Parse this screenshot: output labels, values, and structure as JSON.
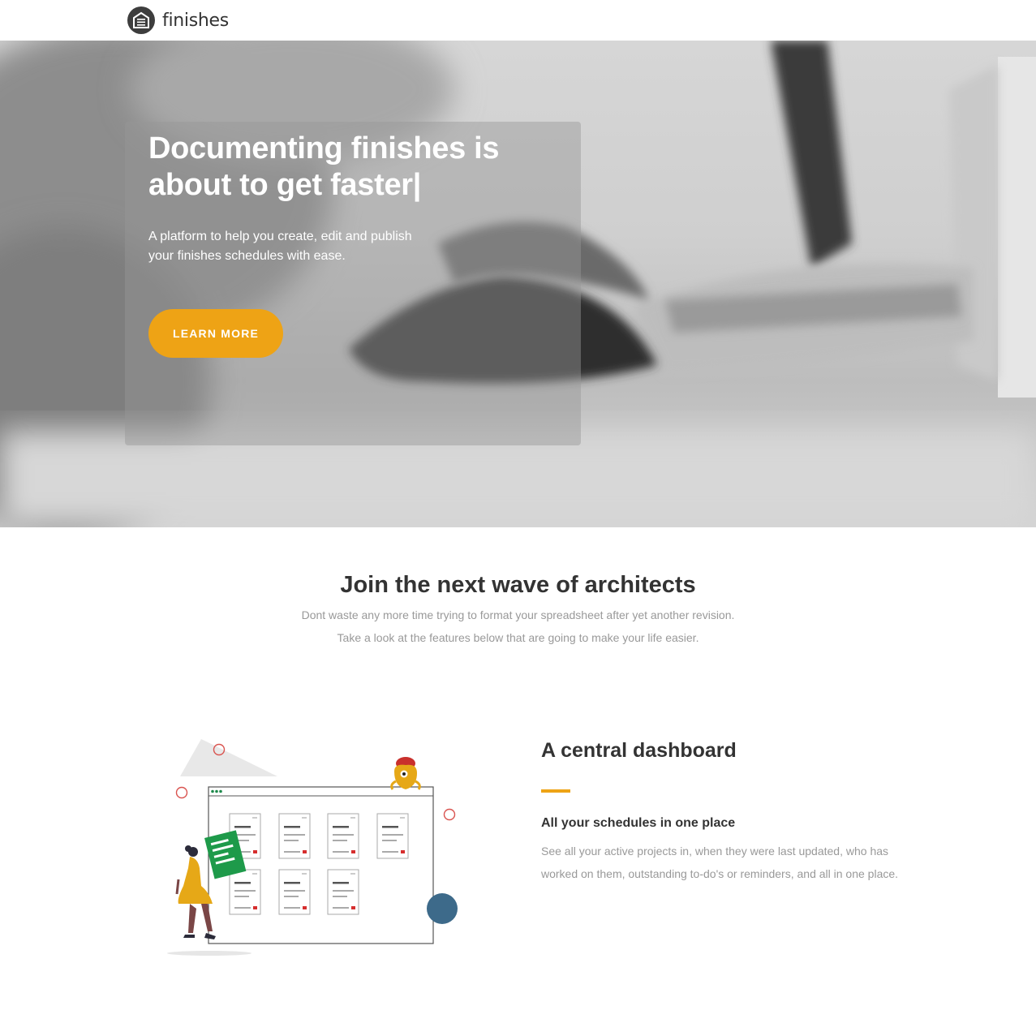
{
  "header": {
    "logo_text": "finishes",
    "logo_icon": "building-doc-icon"
  },
  "hero": {
    "title_line1": "Documenting finishes is",
    "title_line2": "about to get faster|",
    "subtitle_line1": "A platform to help you create, edit and publish",
    "subtitle_line2": "your finishes schedules with ease.",
    "cta_label": "LEARN MORE",
    "background": "hand-on-mouse-photo"
  },
  "intro": {
    "title": "Join the next wave of architects",
    "line1": "Dont waste any more time trying to format your spreadsheet after yet another revision.",
    "line2": "Take a look at the features below that are going to make your life easier."
  },
  "feature": {
    "illustration": "dashboard-illustration",
    "title": "A central dashboard",
    "subtitle": "All your schedules in one place",
    "description": "See all your active projects in, when they were last updated, who has worked on them, outstanding to-do's or reminders, and all in one place."
  },
  "colors": {
    "accent": "#eea315",
    "text_dark": "#333333",
    "text_muted": "#999999",
    "logo_bg": "#3d3d3d"
  }
}
